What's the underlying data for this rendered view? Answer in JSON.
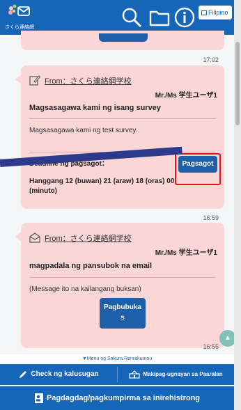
{
  "header": {
    "logo_text": "さくら連絡網",
    "lang_label": "Filipino",
    "icons": [
      "search-icon",
      "folder-icon",
      "info-icon"
    ]
  },
  "messages": [
    {
      "time": "17:02",
      "from": "From：さくら連絡網学校",
      "to": "Mr./Ms 学生ユーザ1",
      "subject": "Magsasagawa kami ng isang survey",
      "body": "Magsasagawa kami ng test survey.",
      "deadline_label": "Deadline ng pagsagot：",
      "deadline_value": "Hanggang 12 (buwan) 21 (araw) 18 (oras) 00 (minuto)",
      "button_label": "Pagsagot"
    },
    {
      "time": "16:59",
      "from": "From：さくら連絡網学校",
      "to": "Mr./Ms 学生ユーザ1",
      "subject": "magpadala ng pansubok na email",
      "body": "(Message ito na kailangang buksan)",
      "button_label": "Pagbubuka s",
      "time_bottom": "16:55"
    }
  ],
  "bottom": {
    "menu_label": "▼Menu ng Sakura Renrakumou",
    "health_check": "Check ng kalusugan",
    "school_contact": "Makipag-ugnayan sa Paaralan",
    "registration": "Pagdagdag/pagkumpirma sa inirehistrong"
  },
  "colors": {
    "primary": "#1565b8",
    "card": "#fad6d6",
    "button": "#1d5fa8",
    "highlight": "#e3141b"
  }
}
